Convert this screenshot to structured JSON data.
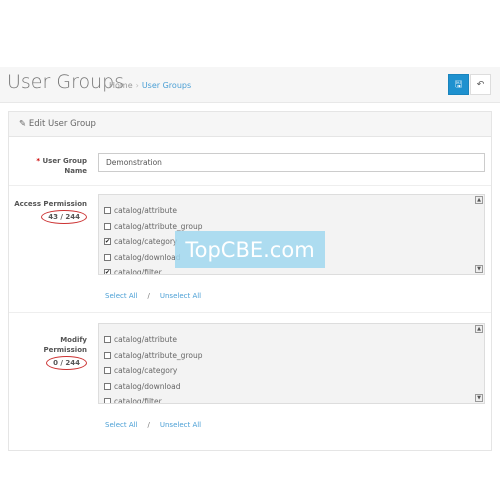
{
  "header": {
    "title": "User Groups",
    "breadcrumb": [
      "Home",
      "User Groups"
    ],
    "save_icon": "save-icon",
    "back_icon": "reply-icon"
  },
  "panel": {
    "heading": "Edit User Group",
    "heading_icon": "pencil-icon"
  },
  "form": {
    "name": {
      "required_mark": "*",
      "label": "User Group Name",
      "value": "Demonstration"
    },
    "access": {
      "label": "Access Permission",
      "count": "43 / 244",
      "items": [
        {
          "label": "catalog/attribute",
          "checked": false
        },
        {
          "label": "catalog/attribute_group",
          "checked": false
        },
        {
          "label": "catalog/category",
          "checked": true
        },
        {
          "label": "catalog/download",
          "checked": false
        },
        {
          "label": "catalog/filter",
          "checked": true
        }
      ],
      "select_all": "Select All",
      "separator": "/",
      "unselect_all": "Unselect All"
    },
    "modify": {
      "label": "Modify Permission",
      "count": "0 / 244",
      "items": [
        {
          "label": "catalog/attribute",
          "checked": false
        },
        {
          "label": "catalog/attribute_group",
          "checked": false
        },
        {
          "label": "catalog/category",
          "checked": false
        },
        {
          "label": "catalog/download",
          "checked": false
        },
        {
          "label": "catalog/filter",
          "checked": false
        }
      ],
      "select_all": "Select All",
      "separator": "/",
      "unselect_all": "Unselect All"
    }
  },
  "watermark": "TopCBE.com",
  "colors": {
    "primary": "#1e91cf",
    "link": "#4a9fd5",
    "highlight": "#cc3333"
  }
}
